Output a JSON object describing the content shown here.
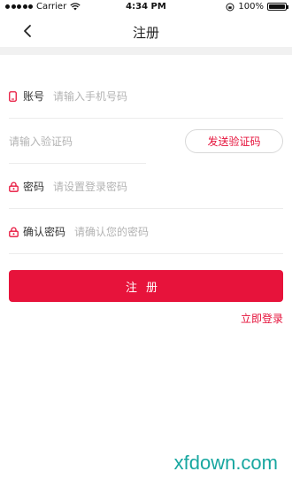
{
  "status_bar": {
    "carrier": "Carrier",
    "time": "4:34 PM",
    "battery": "100%",
    "battery_level": 1.0
  },
  "nav": {
    "title": "注册"
  },
  "form": {
    "phone": {
      "label": "账号",
      "placeholder": "请输入手机号码"
    },
    "code": {
      "placeholder": "请输入验证码"
    },
    "send_code_label": "发送验证码",
    "password": {
      "label": "密码",
      "placeholder": "请设置登录密码"
    },
    "confirm": {
      "label": "确认密码",
      "placeholder": "请确认您的密码"
    }
  },
  "actions": {
    "register_label": "注册",
    "login_link": "立即登录"
  },
  "watermark": "xfdown.com",
  "colors": {
    "accent": "#e7133b",
    "watermark": "#18a7a0"
  },
  "icons": {
    "back": "chevron-left-icon",
    "phone": "phone-icon",
    "lock": "lock-icon"
  }
}
